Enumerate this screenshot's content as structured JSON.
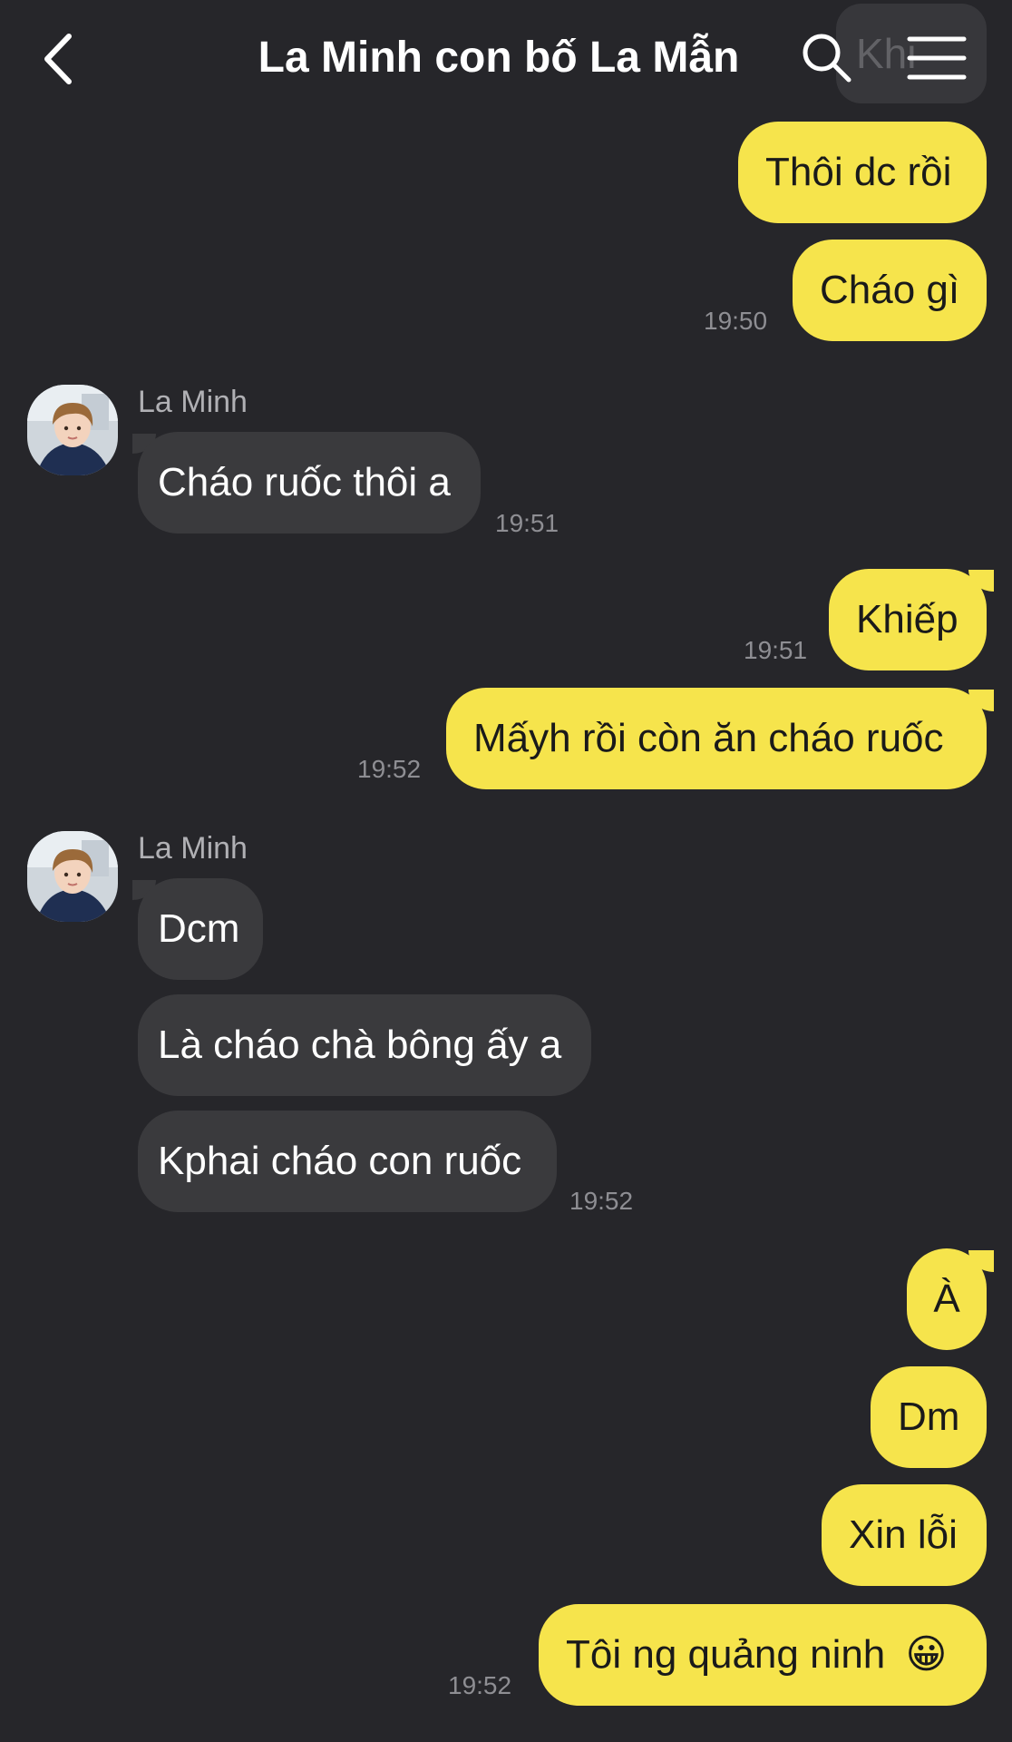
{
  "header": {
    "title": "La Minh con bố La Mẫn",
    "ghost_text": "Khi"
  },
  "messages": [
    {
      "from": "me",
      "text": "Thôi dc rồi",
      "time": ""
    },
    {
      "from": "me",
      "text": "Cháo gì",
      "time": "19:50"
    },
    {
      "from": "La Minh",
      "sender_label": "La Minh",
      "text": "Cháo ruốc thôi a",
      "time": "19:51"
    },
    {
      "from": "me",
      "text": "Khiếp",
      "time": "19:51"
    },
    {
      "from": "me",
      "text": "Mấyh rồi còn ăn cháo ruốc",
      "time": "19:52"
    },
    {
      "from": "La Minh",
      "sender_label": "La Minh",
      "text": "Dcm",
      "time": ""
    },
    {
      "from": "La Minh",
      "text": "Là cháo chà bông ấy a",
      "time": ""
    },
    {
      "from": "La Minh",
      "text": "Kphai cháo con ruốc",
      "time": "19:52"
    },
    {
      "from": "me",
      "text": "À",
      "time": ""
    },
    {
      "from": "me",
      "text": "Dm",
      "time": ""
    },
    {
      "from": "me",
      "text": "Xin lỗi",
      "time": ""
    },
    {
      "from": "me",
      "text": "Tôi ng quảng ninh",
      "emoji": "😀",
      "time": "19:52"
    }
  ],
  "colors": {
    "background": "#26262a",
    "outgoing_bubble": "#f6e44c",
    "incoming_bubble": "#3a3a3d",
    "timestamp": "#8e8e93"
  },
  "icons": [
    "back-chevron-icon",
    "search-icon",
    "menu-icon",
    "avatar"
  ]
}
